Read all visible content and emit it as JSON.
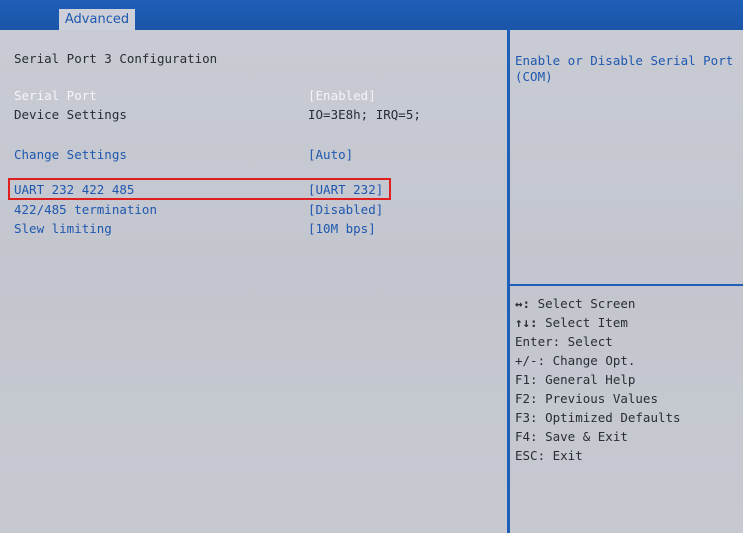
{
  "header": {
    "tab_label": "Advanced"
  },
  "main": {
    "section_title": "Serial Port 3 Configuration",
    "rows": [
      {
        "label": "Serial Port",
        "value": "[Enabled]"
      },
      {
        "label": "Device Settings",
        "value": "IO=3E8h; IRQ=5;"
      },
      {
        "label": "Change Settings",
        "value": "[Auto]"
      },
      {
        "label": "UART 232 422 485",
        "value": "[UART 232]"
      },
      {
        "label": "422/485 termination",
        "value": "[Disabled]"
      },
      {
        "label": "Slew limiting",
        "value": "[10M bps]"
      }
    ]
  },
  "help": {
    "description": "Enable or Disable Serial Port (COM)",
    "keys": [
      {
        "key": "↔:",
        "action": " Select Screen"
      },
      {
        "key": "↑↓:",
        "action": " Select Item"
      },
      {
        "key": "Enter:",
        "action": " Select"
      },
      {
        "key": "+/-:",
        "action": " Change Opt."
      },
      {
        "key": "F1:",
        "action": " General Help"
      },
      {
        "key": "F2:",
        "action": " Previous Values"
      },
      {
        "key": "F3:",
        "action": " Optimized Defaults"
      },
      {
        "key": "F4:",
        "action": " Save & Exit"
      },
      {
        "key": "ESC:",
        "action": " Exit"
      }
    ]
  },
  "colors": {
    "header_blue": "#1f5fb8",
    "background": "#c6c9d0",
    "highlight_red": "#e02020",
    "accent_blue": "#1f58b0"
  }
}
